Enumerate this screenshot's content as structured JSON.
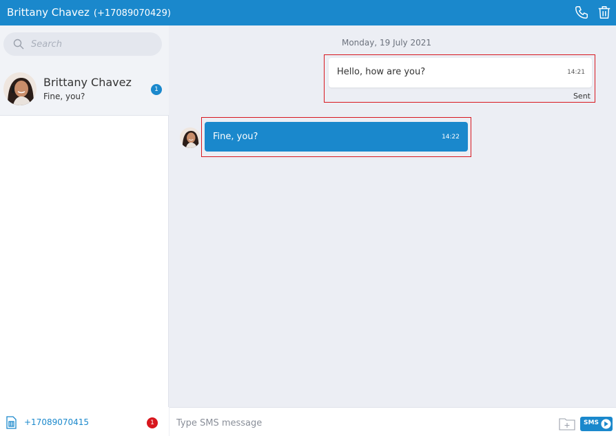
{
  "header": {
    "contact_name": "Brittany Chavez",
    "contact_phone": "(+17089070429)"
  },
  "search": {
    "placeholder": "Search"
  },
  "conversations": [
    {
      "name": "Brittany Chavez",
      "preview": "Fine, you?",
      "unread": "1"
    }
  ],
  "chat": {
    "date": "Monday, 19 July 2021",
    "messages": [
      {
        "direction": "outgoing",
        "text": "Hello, how are you?",
        "time": "14:21",
        "status": "Sent"
      },
      {
        "direction": "incoming",
        "text": "Fine, you?",
        "time": "14:22"
      }
    ]
  },
  "footer": {
    "sim_number": "+17089070415",
    "sim_badge": "1"
  },
  "composer": {
    "placeholder": "Type SMS message",
    "send_label": "SMS"
  },
  "colors": {
    "accent": "#1a88cc",
    "alert": "#d8161d",
    "chat_bg": "#eceef4"
  }
}
